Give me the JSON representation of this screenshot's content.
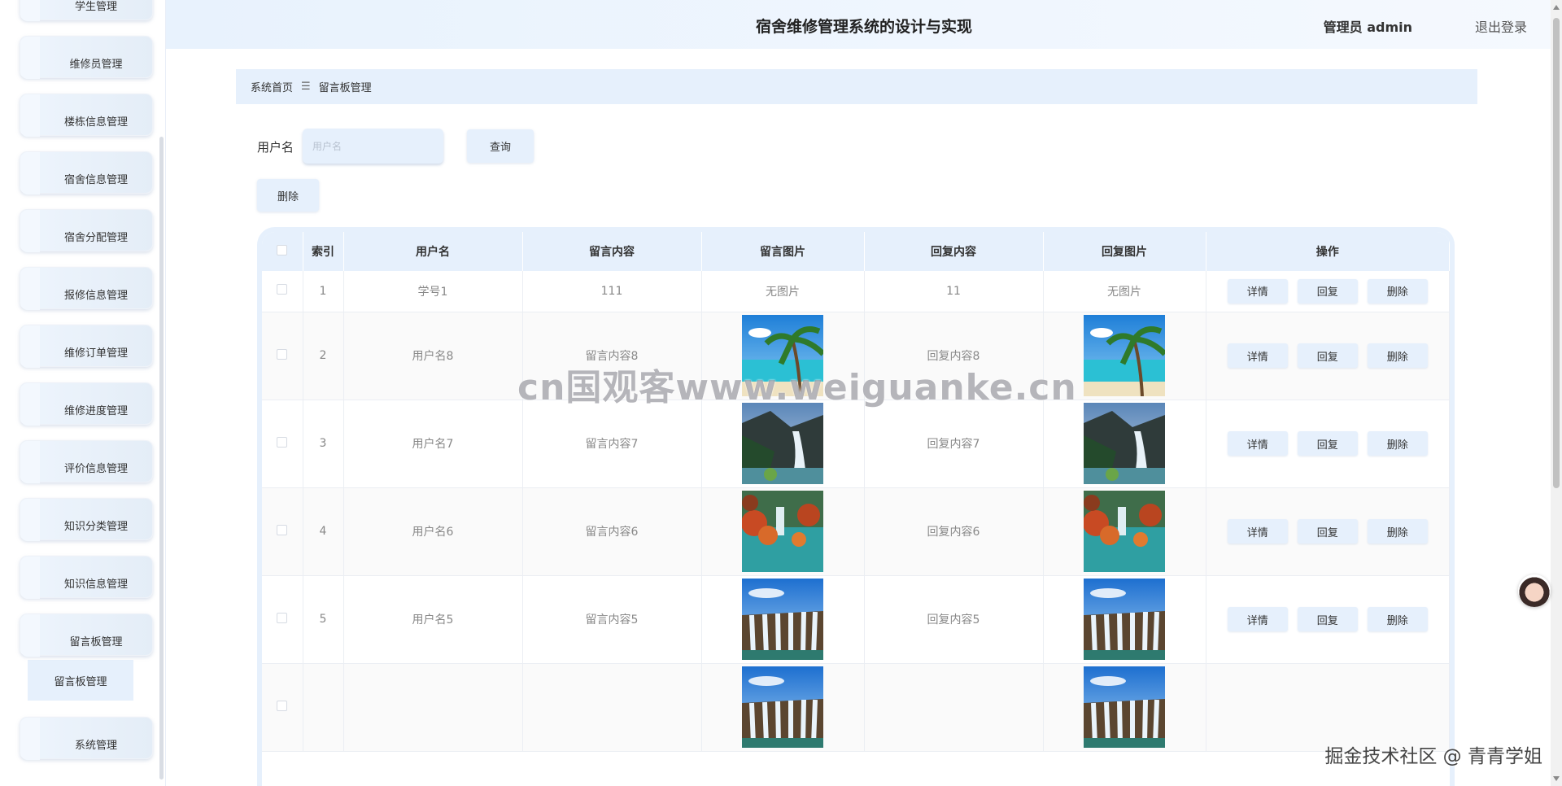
{
  "sidebar": {
    "items": [
      "学生管理",
      "维修员管理",
      "楼栋信息管理",
      "宿舍信息管理",
      "宿舍分配管理",
      "报修信息管理",
      "维修订单管理",
      "维修进度管理",
      "评价信息管理",
      "知识分类管理",
      "知识信息管理",
      "留言板管理"
    ],
    "submenu": "留言板管理",
    "last_item": "系统管理"
  },
  "header": {
    "title": "宿舍维修管理系统的设计与实现",
    "user": "管理员 admin",
    "logout": "退出登录"
  },
  "breadcrumb": {
    "home": "系统首页",
    "separator": "三",
    "current": "留言板管理"
  },
  "search": {
    "label": "用户名",
    "placeholder": "用户名",
    "query_button": "查询",
    "delete_button": "删除"
  },
  "table": {
    "columns": [
      "索引",
      "用户名",
      "留言内容",
      "留言图片",
      "回复内容",
      "回复图片",
      "操作"
    ],
    "no_image": "无图片",
    "ops": [
      "详情",
      "回复",
      "删除"
    ],
    "rows": [
      {
        "index": "1",
        "username": "学号1",
        "content": "111",
        "image": "none",
        "reply": "11",
        "reply_image": "none"
      },
      {
        "index": "2",
        "username": "用户名8",
        "content": "留言内容8",
        "image": "beach-palm",
        "reply": "回复内容8",
        "reply_image": "beach-palm"
      },
      {
        "index": "3",
        "username": "用户名7",
        "content": "留言内容7",
        "image": "waterfall-cliff",
        "reply": "回复内容7",
        "reply_image": "waterfall-cliff"
      },
      {
        "index": "4",
        "username": "用户名6",
        "content": "留言内容6",
        "image": "lake-autumn",
        "reply": "回复内容6",
        "reply_image": "lake-autumn"
      },
      {
        "index": "5",
        "username": "用户名5",
        "content": "留言内容5",
        "image": "waterfall-wide",
        "reply": "回复内容5",
        "reply_image": "waterfall-wide"
      },
      {
        "index": "",
        "username": "",
        "content": "",
        "image": "waterfall-wide",
        "reply": "",
        "reply_image": "waterfall-wide"
      }
    ]
  },
  "overlay": {
    "watermark": "cn国观客www.weiguanke.cn",
    "credit": "掘金技术社区 @ 青青学姐"
  },
  "colors": {
    "accent": "#e6f0fc",
    "header_bg": "#e8f2fd"
  }
}
